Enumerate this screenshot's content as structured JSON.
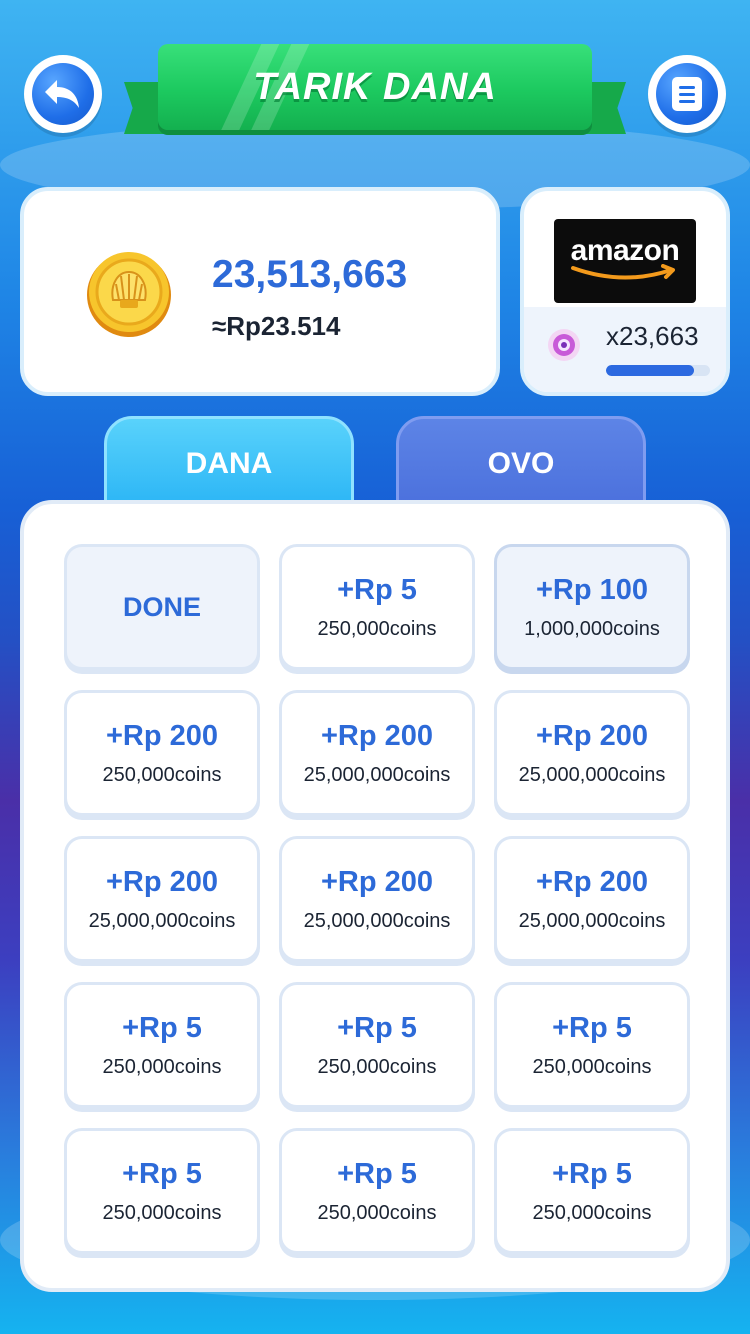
{
  "header": {
    "title": "TARIK DANA"
  },
  "balance": {
    "coins": "23,513,663",
    "approx_value": "≈Rp23.514"
  },
  "reward_card": {
    "brand": "amazon",
    "count": "x23,663",
    "progress": 0.85
  },
  "tabs": [
    {
      "label": "DANA",
      "active": true
    },
    {
      "label": "OVO",
      "active": false
    }
  ],
  "options": [
    {
      "type": "done",
      "label": "DONE"
    },
    {
      "amount": "+Rp 5",
      "coins": "250,000coins"
    },
    {
      "amount": "+Rp 100",
      "coins": "1,000,000coins"
    },
    {
      "amount": "+Rp 200",
      "coins": "250,000coins"
    },
    {
      "amount": "+Rp 200",
      "coins": "25,000,000coins"
    },
    {
      "amount": "+Rp 200",
      "coins": "25,000,000coins"
    },
    {
      "amount": "+Rp 200",
      "coins": "25,000,000coins"
    },
    {
      "amount": "+Rp 200",
      "coins": "25,000,000coins"
    },
    {
      "amount": "+Rp 200",
      "coins": "25,000,000coins"
    },
    {
      "amount": "+Rp 5",
      "coins": "250,000coins"
    },
    {
      "amount": "+Rp 5",
      "coins": "250,000coins"
    },
    {
      "amount": "+Rp 5",
      "coins": "250,000coins"
    },
    {
      "amount": "+Rp 5",
      "coins": "250,000coins"
    },
    {
      "amount": "+Rp 5",
      "coins": "250,000coins"
    },
    {
      "amount": "+Rp 5",
      "coins": "250,000coins"
    }
  ],
  "colors": {
    "accent_blue": "#2d6ad8",
    "banner_green": "#1cc95f"
  }
}
